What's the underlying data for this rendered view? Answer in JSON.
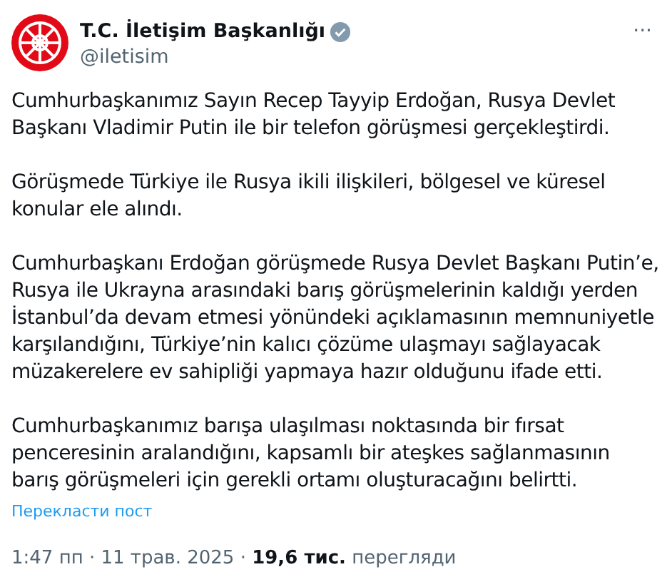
{
  "author": {
    "name": "T.C. İletişim Başkanlığı",
    "verified": true,
    "handle": "@iletisim"
  },
  "menu": "···",
  "paragraphs": [
    "Cumhurbaşkanımız Sayın Recep Tayyip Erdoğan, Rusya Devlet Başkanı Vladimir Putin ile bir telefon görüşmesi gerçekleştirdi.",
    "Görüşmede Türkiye ile Rusya ikili ilişkileri, bölgesel ve küresel konular ele alındı.",
    "Cumhurbaşkanı Erdoğan görüşmede Rusya Devlet Başkanı Putin’e, Rusya ile Ukrayna arasındaki barış görüşmelerinin kaldığı yerden İstanbul’da devam etmesi yönündeki açıklamasının memnuniyetle karşılandığını, Türkiye’nin kalıcı çözüme ulaşmayı sağlayacak müzakerelere ev sahipliği yapmaya hazır olduğunu ifade etti.",
    "Cumhurbaşkanımız barışa ulaşılması noktasında bir fırsat penceresinin aralandığını, kapsamlı bir ateşkes sağlanmasının barış görüşmeleri için gerekli ortamı oluşturacağını belirtti."
  ],
  "translate_link": "Перекласти пост",
  "meta": "1:47 пп · 11 трав. 2025 · **19,6 тис.** перегляди"
}
